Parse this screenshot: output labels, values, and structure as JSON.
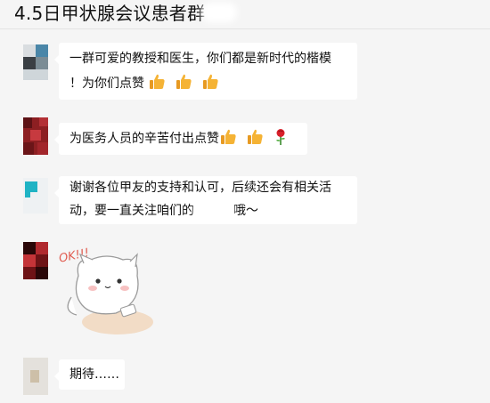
{
  "header": {
    "title": "4.5日甲状腺会议患者群"
  },
  "messages": [
    {
      "line1": "一群可爱的教授和医生，你们都是新时代的楷模",
      "line2": "！为你们点赞"
    },
    {
      "text": "为医务人员的辛苦付出点赞"
    },
    {
      "line1": "谢谢各位甲友的支持和认可，后续还会有相关活",
      "line2_a": "动，要一直关注咱们的",
      "line2_b": "哦～"
    },
    {
      "sticker_text": "OK!!!"
    },
    {
      "text": "期待……"
    }
  ],
  "icons": [
    "thumbs-up-icon",
    "rose-icon"
  ],
  "colors": {
    "background": "#f5f5f5",
    "bubble": "#ffffff",
    "thumb": "#f5b335",
    "rose_red": "#d8202a"
  }
}
